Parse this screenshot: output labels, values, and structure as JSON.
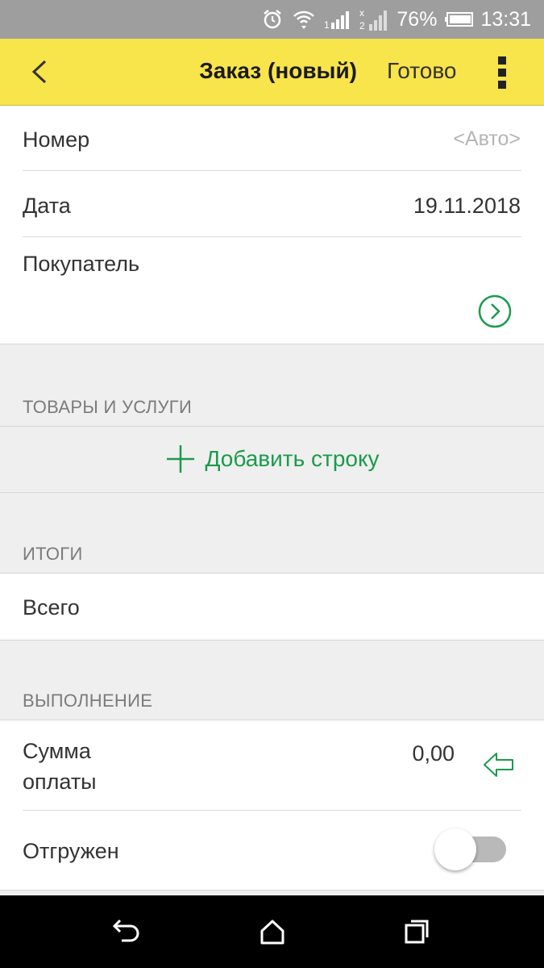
{
  "status_bar": {
    "icons": [
      "alarm-icon",
      "wifi-icon",
      "signal-1-icon",
      "signal-2-icon",
      "battery-icon"
    ],
    "battery_percent": "76%",
    "time": "13:31"
  },
  "app_bar": {
    "title": "Заказ (новый)",
    "done_label": "Готово",
    "icons": [
      "back-chevron-icon",
      "more-vert-icon"
    ]
  },
  "fields": {
    "number": {
      "label": "Номер",
      "placeholder": "<Авто>"
    },
    "date": {
      "label": "Дата",
      "value": "19.11.2018"
    },
    "buyer": {
      "label": "Покупатель",
      "icon": "chevron-right-circle-icon"
    }
  },
  "goods_section": {
    "header": "ТОВАРЫ И УСЛУГИ",
    "add_row_label": "Добавить строку",
    "add_icon": "plus-icon"
  },
  "totals_section": {
    "header": "ИТОГИ",
    "total_label": "Всего"
  },
  "fulfillment_section": {
    "header": "ВЫПОЛНЕНИЕ",
    "payment_label_line1": "Сумма",
    "payment_label_line2": "оплаты",
    "payment_value": "0,00",
    "payment_icon": "arrow-left-outline-icon",
    "shipped_label": "Отгружен",
    "shipped_on": false
  },
  "nav_bar": {
    "icons": [
      "back-nav-icon",
      "home-icon",
      "recents-icon"
    ]
  },
  "colors": {
    "accent_yellow": "#f8e44b",
    "accent_green": "#1a9b4b",
    "status_bar": "#9e9e9e"
  }
}
